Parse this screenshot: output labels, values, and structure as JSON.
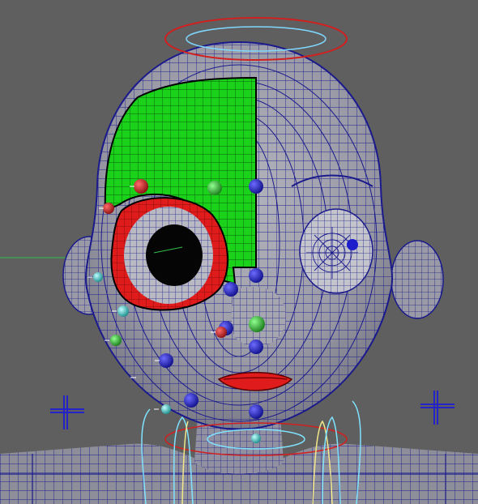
{
  "viewport": {
    "background_color": "#5f5f5f",
    "mesh_wire_color": "#1a1a8c",
    "mesh_surface_color": "#9a9aa6",
    "selected_faces_color": "#19d219",
    "eye_region_color": "#e01b1b",
    "halo_outer_color": "#d02020",
    "halo_inner_color": "#7fd8ff",
    "axis_line_color": "#2fbf4a",
    "locator_color": "#2323c8",
    "curve_cyan_color": "#7fe3ff",
    "curve_yellow_color": "#f2e88a"
  },
  "objects": {
    "head": "head-mesh",
    "body": "body-mesh",
    "halo": "halo-control",
    "left_locator": "cross-locator",
    "right_locator": "cross-locator",
    "neck_curves": "neck-control-curves"
  },
  "joint_colors": {
    "blue": "#1d1dcc",
    "red": "#d41a1a",
    "green": "#2bb52b",
    "cyan": "#2fd0d0"
  },
  "icons": {
    "locator": "plus-cross-icon",
    "joint": "joint-sphere-icon"
  }
}
